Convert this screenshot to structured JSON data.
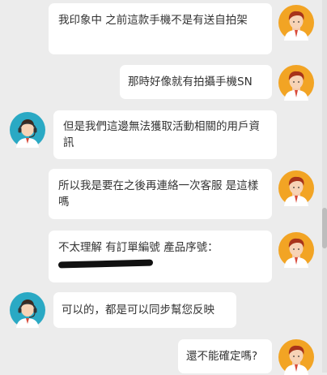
{
  "chat": {
    "messages": [
      {
        "sender": "user",
        "text": "我印象中 之前這款手機不是有送自拍架"
      },
      {
        "sender": "user",
        "text": "那時好像就有拍攝手機SN"
      },
      {
        "sender": "agent",
        "text": "但是我們這邊無法獲取活動相關的用戶資訊"
      },
      {
        "sender": "user",
        "text": "所以我是要在之後再連絡一次客服 是這樣嗎"
      },
      {
        "sender": "user",
        "text": "不太理解 有訂單編號 產品序號："
      },
      {
        "sender": "agent",
        "text": "可以的，都是可以同步幫您反映"
      },
      {
        "sender": "user",
        "text": "還不能確定嗎?"
      }
    ]
  },
  "icons": {
    "user_avatar": "user-avatar-icon",
    "agent_avatar": "agent-headset-avatar-icon"
  },
  "colors": {
    "background": "#ececec",
    "bubble": "#ffffff",
    "user_avatar_bg": "#f2a424",
    "agent_avatar_bg": "#2aa9c4"
  }
}
